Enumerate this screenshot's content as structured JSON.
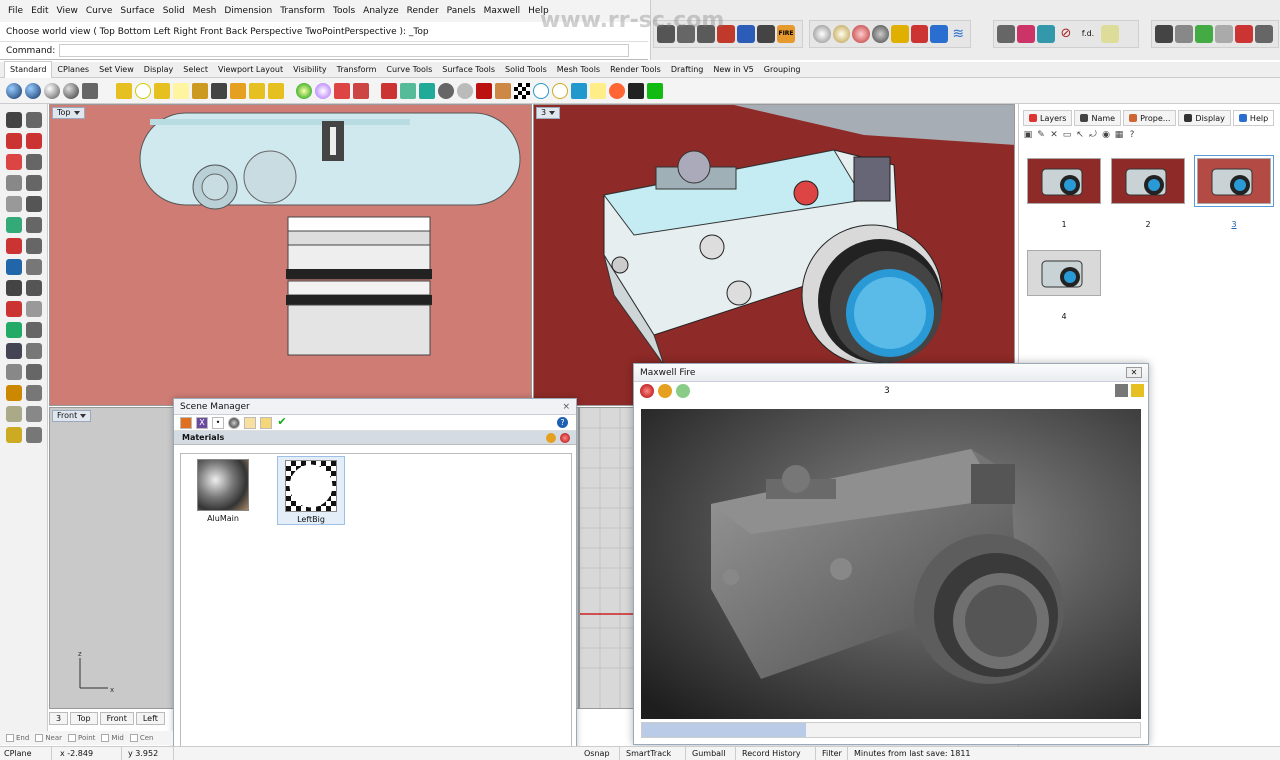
{
  "menu": [
    "File",
    "Edit",
    "View",
    "Curve",
    "Surface",
    "Solid",
    "Mesh",
    "Dimension",
    "Transform",
    "Tools",
    "Analyze",
    "Render",
    "Panels",
    "Maxwell",
    "Help"
  ],
  "history_line": "Choose world view ( Top  Bottom  Left  Right  Front  Back  Perspective  TwoPointPerspective ): _Top",
  "command_label": "Command:",
  "watermark_url": "www.rr-sc.com",
  "toolbar_tabs": [
    "Standard",
    "CPlanes",
    "Set View",
    "Display",
    "Select",
    "Viewport Layout",
    "Visibility",
    "Transform",
    "Curve Tools",
    "Surface Tools",
    "Solid Tools",
    "Mesh Tools",
    "Render Tools",
    "Drafting",
    "New in V5",
    "Grouping"
  ],
  "fire_badge": "FIRE",
  "fd_label": "f.d.",
  "viewports": {
    "top_label": "Top",
    "persp_label": "3",
    "front_label": "Front"
  },
  "right_panel": {
    "tabs": [
      "Layers",
      "Name",
      "Prope...",
      "Display",
      "Help"
    ],
    "thumbnails": [
      "1",
      "2",
      "3",
      "4"
    ],
    "selected_thumbnail": "3"
  },
  "scene_manager": {
    "title": "Scene Manager",
    "section": "Materials",
    "help": "?",
    "materials": [
      "AluMain",
      "LeftBig"
    ]
  },
  "fire_window": {
    "title": "Maxwell Fire",
    "view": "3",
    "close": "✕",
    "progress": 0.33
  },
  "viewport_tabs": [
    "3",
    "Top",
    "Front",
    "Left"
  ],
  "osnap": [
    "End",
    "Near",
    "Point",
    "Mid",
    "Cen"
  ],
  "status": {
    "cplane": "CPlane",
    "x": "x -2.849",
    "y": "y 3.952",
    "items": [
      "Osnap",
      "SmartTrack",
      "Gumball",
      "Record History",
      "Filter"
    ],
    "autosave": "Minutes from last save: 1811"
  },
  "colors": {
    "top_viewport": "#cf7d74",
    "persp_viewport": "#8e2a27",
    "lens_blue": "#2a9ad6",
    "camera_body": "#c4ecf2"
  }
}
